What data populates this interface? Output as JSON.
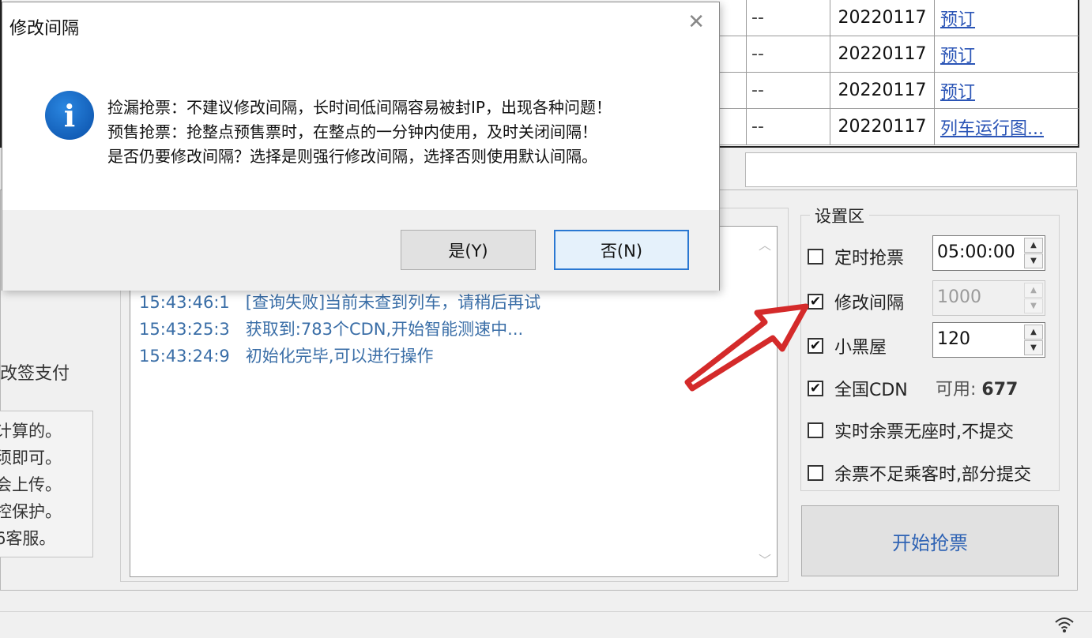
{
  "train_table": {
    "rows": [
      {
        "dash": "--",
        "date": "20220117",
        "action": "预订"
      },
      {
        "dash": "--",
        "date": "20220117",
        "action": "预订"
      },
      {
        "dash": "--",
        "date": "20220117",
        "action": "预订"
      },
      {
        "dash": "--",
        "date": "20220117",
        "action": "列车运行图..."
      }
    ]
  },
  "left_panel": {
    "partial_label": "改签支付",
    "notes": [
      "计算的。",
      "须即可。",
      "会上传。",
      "控保护。",
      "6客服。"
    ]
  },
  "log": {
    "lines": [
      {
        "time": "15:43:46:1",
        "text": "[查询失败]当前未查到列车，请稍后再试"
      },
      {
        "time": "15:43:25:3",
        "text": "获取到:783个CDN,开始智能测速中..."
      },
      {
        "time": "15:43:24:9",
        "text": "初始化完毕,可以进行操作"
      }
    ]
  },
  "settings": {
    "title": "设置区",
    "timed": {
      "label": "定时抢票",
      "checked": false,
      "value": "05:00:00"
    },
    "interval": {
      "label": "修改间隔",
      "checked": true,
      "value": "1000"
    },
    "blackroom": {
      "label": "小黑屋",
      "checked": true,
      "value": "120"
    },
    "cdn": {
      "label": "全国CDN",
      "checked": true,
      "available_label": "可用:",
      "available_count": "677"
    },
    "no_seat": {
      "label": "实时余票无座时,不提交",
      "checked": false
    },
    "partial": {
      "label": "余票不足乘客时,部分提交",
      "checked": false
    }
  },
  "start_button": {
    "label": "开始抢票"
  },
  "dialog": {
    "title": "修改间隔",
    "close": "✕",
    "icon": "info-icon",
    "lines": [
      "捡漏抢票：不建议修改间隔，长时间低间隔容易被封IP，出现各种问题！",
      "预售抢票：抢整点预售票时，在整点的一分钟内使用，及时关闭间隔！",
      "是否仍要修改间隔？选择是则强行修改间隔，选择否则使用默认间隔。"
    ],
    "yes_label": "是(Y)",
    "no_label": "否(N)"
  },
  "colors": {
    "accent": "#2a78d2",
    "link": "#2b55b6",
    "log_text": "#3a6ea7",
    "arrow": "#d42a2a"
  }
}
